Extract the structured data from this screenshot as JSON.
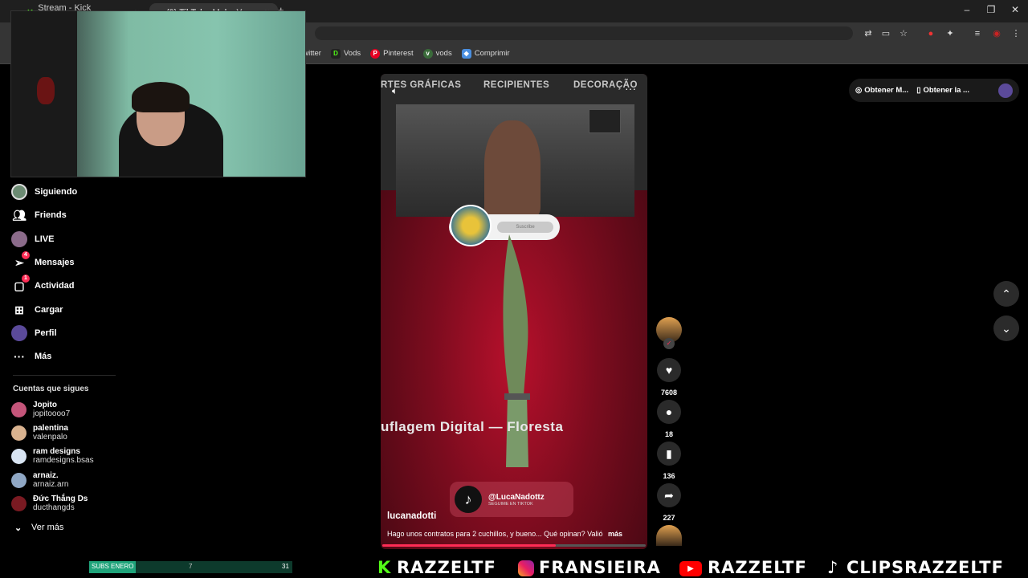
{
  "browser": {
    "tabs": [
      {
        "label": "Stream - Kick Dashboard"
      },
      {
        "label": "(9) TikTok - Make Your Day"
      }
    ],
    "bookmarks": [
      {
        "label": "Twitter"
      },
      {
        "label": "Vods"
      },
      {
        "label": "Pinterest"
      },
      {
        "label": "vods"
      },
      {
        "label": "Comprimir"
      }
    ]
  },
  "sidebar": {
    "nav": [
      {
        "label": "Siguiendo",
        "icon": "avatar-icon"
      },
      {
        "label": "Friends",
        "icon": "friends-icon"
      },
      {
        "label": "LIVE",
        "icon": "live-icon"
      },
      {
        "label": "Mensajes",
        "icon": "send-icon",
        "badge": "4"
      },
      {
        "label": "Actividad",
        "icon": "activity-icon",
        "badge": "1"
      },
      {
        "label": "Cargar",
        "icon": "upload-icon"
      },
      {
        "label": "Perfil",
        "icon": "profile-icon"
      },
      {
        "label": "Más",
        "icon": "more-icon"
      }
    ],
    "following_title": "Cuentas que sigues",
    "following": [
      {
        "name": "Jopito",
        "handle": "jopitoooo7"
      },
      {
        "name": "palentina",
        "handle": "valenpalo"
      },
      {
        "name": "ram designs",
        "handle": "ramdesigns.bsas"
      },
      {
        "name": "arnaiz.",
        "handle": "arnaiz.arn"
      },
      {
        "name": "Đức Thắng Ds",
        "handle": "ducthangds"
      }
    ],
    "see_more": "Ver más"
  },
  "topright": {
    "app_button": "Obtener M...",
    "app2_button": "Obtener la ..."
  },
  "video": {
    "categories": [
      "RTES GRÁFICAS",
      "RECIPIENTES",
      "DECORAÇÃO"
    ],
    "subscribe": "Suscribe",
    "overlay_title": "uflagem Digital — Floresta",
    "watermark_handle": "@LucaNadottz",
    "watermark_sub": "SEGUIME EN TIKTOK",
    "author": "lucanadotti",
    "caption": "Hago unos contratos para 2 cuchillos, y bueno... Qué opinan? Valió",
    "more": "más",
    "progress": 0.66
  },
  "actions": {
    "likes": "7608",
    "comments": "18",
    "saves": "136",
    "shares": "227"
  },
  "stream_overlay": {
    "subgoal_label": "SUBS ENERO",
    "subgoal_current": "7",
    "subgoal_target": "31",
    "subgoal_fraction": 0.23,
    "social1": "RAZZELTF",
    "social2": "FRANSIEIRA",
    "social3": "RAZZELTF",
    "social4": "CLIPSRAZZELTF"
  },
  "colors": {
    "accent": "#fe2c55",
    "kick_green": "#53fc18",
    "subgoal": "#1fa37a"
  }
}
